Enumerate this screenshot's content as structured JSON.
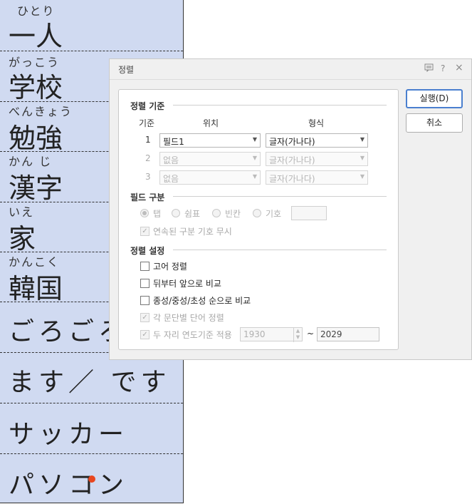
{
  "document": {
    "words": [
      {
        "ruby": "ひとり",
        "text": "一人"
      },
      {
        "ruby": "がっこう",
        "text": "学校"
      },
      {
        "ruby": "べんきょう",
        "text": "勉強"
      },
      {
        "ruby": "かん じ",
        "text": "漢字"
      },
      {
        "ruby": "いえ",
        "text": "家"
      },
      {
        "ruby": "かんこく",
        "text": "韓国"
      },
      {
        "ruby": "",
        "text": "ごろごろ"
      },
      {
        "ruby": "",
        "text": "ます／ です"
      },
      {
        "ruby": "",
        "text": "サッカー"
      },
      {
        "ruby": "",
        "text": "パソコン"
      }
    ]
  },
  "dialog": {
    "title": "정렬",
    "icons": {
      "help": "?",
      "close": "×",
      "comment": "comment-icon"
    },
    "sort_criteria": {
      "section": "정렬 기준",
      "headers": {
        "key": "기준",
        "position": "위치",
        "format": "형식"
      },
      "rows": [
        {
          "num": "1",
          "position": "필드1",
          "format": "글자(가나다)",
          "enabled": true
        },
        {
          "num": "2",
          "position": "없음",
          "format": "글자(가나다)",
          "enabled": false
        },
        {
          "num": "3",
          "position": "없음",
          "format": "글자(가나다)",
          "enabled": false
        }
      ]
    },
    "field_separator": {
      "section": "필드 구분",
      "options": [
        "탭",
        "쉼표",
        "빈칸",
        "기호"
      ],
      "selected": "탭",
      "ignore_consecutive": "연속된 구분 기호 무시"
    },
    "sort_settings": {
      "section": "정렬 설정",
      "options": [
        {
          "label": "고어 정렬",
          "checked": false,
          "enabled": true
        },
        {
          "label": "뒤부터 앞으로 비교",
          "checked": false,
          "enabled": true
        },
        {
          "label": "종성/중성/초성 순으로 비교",
          "checked": false,
          "enabled": true
        },
        {
          "label": "각 문단별 단어 정렬",
          "checked": true,
          "enabled": false
        },
        {
          "label": "두 자리 연도기준 적용",
          "checked": true,
          "enabled": false
        }
      ],
      "year_from": "1930",
      "tilde": "~",
      "year_to": "2029"
    },
    "buttons": {
      "run": "실행(D)",
      "cancel": "취소"
    }
  }
}
